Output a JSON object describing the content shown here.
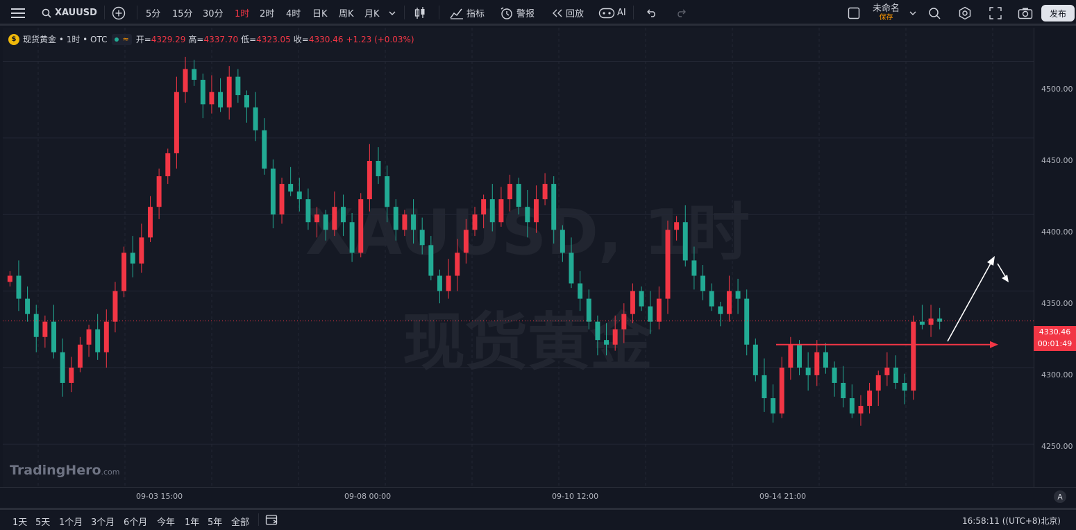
{
  "toolbar": {
    "symbol": "XAUUSD",
    "timeframes": [
      "5分",
      "15分",
      "30分",
      "1时",
      "2时",
      "4时",
      "日K",
      "周K",
      "月K"
    ],
    "active_timeframe": "1时",
    "indicators": "指标",
    "alerts": "警报",
    "replay": "回放",
    "ai": "AI",
    "layout_name": "未命名",
    "save": "保存",
    "publish": "发布"
  },
  "legend": {
    "instrument": "现货黄金 • 1时 • OTC",
    "open_label": "开=",
    "open": "4329.29",
    "high_label": "高=",
    "high": "4337.70",
    "low_label": "低=",
    "low": "4323.05",
    "close_label": "收=",
    "close": "4330.46",
    "change": "+1.23 (+0.03%)"
  },
  "watermark": {
    "line1": "XAUUSD, 1时",
    "line2": "现货黄金"
  },
  "brand": {
    "name": "TradingHero",
    "suffix": ".com"
  },
  "price_axis": {
    "labels": [
      "4500.00",
      "4450.00",
      "4400.00",
      "4350.00",
      "4300.00",
      "4250.00"
    ],
    "current_price": "4330.46",
    "countdown": "00:01:49"
  },
  "time_axis": {
    "labels": [
      "09-03 15:00",
      "09-08 00:00",
      "09-10 12:00",
      "09-14 21:00"
    ]
  },
  "bottom": {
    "ranges": [
      "1天",
      "5天",
      "1个月",
      "3个月",
      "6个月",
      "今年",
      "1年",
      "5年",
      "全部"
    ],
    "clock": "16:58:11 ((UTC+8)北京)",
    "auto_scale": "A"
  },
  "colors": {
    "up": "#f23645",
    "down": "#22ab94",
    "background": "#131722"
  },
  "chart_data": {
    "type": "candlestick",
    "ylim": [
      4222,
      4522
    ],
    "support_level": 4315,
    "closes": [
      4360,
      4345,
      4335,
      4320,
      4330,
      4310,
      4290,
      4300,
      4315,
      4325,
      4310,
      4330,
      4350,
      4375,
      4368,
      4385,
      4405,
      4425,
      4440,
      4480,
      4495,
      4488,
      4472,
      4480,
      4470,
      4490,
      4478,
      4470,
      4455,
      4430,
      4400,
      4420,
      4415,
      4410,
      4395,
      4400,
      4390,
      4405,
      4395,
      4375,
      4410,
      4435,
      4425,
      4405,
      4390,
      4400,
      4390,
      4380,
      4360,
      4350,
      4360,
      4375,
      4390,
      4400,
      4410,
      4395,
      4410,
      4420,
      4405,
      4395,
      4410,
      4420,
      4390,
      4375,
      4355,
      4345,
      4330,
      4318,
      4315,
      4325,
      4335,
      4350,
      4340,
      4330,
      4345,
      4390,
      4395,
      4370,
      4360,
      4350,
      4340,
      4335,
      4350,
      4345,
      4315,
      4295,
      4280,
      4270,
      4300,
      4315,
      4300,
      4295,
      4310,
      4300,
      4290,
      4280,
      4270,
      4275,
      4285,
      4295,
      4300,
      4290,
      4285,
      4330,
      4328,
      4332,
      4330
    ]
  }
}
